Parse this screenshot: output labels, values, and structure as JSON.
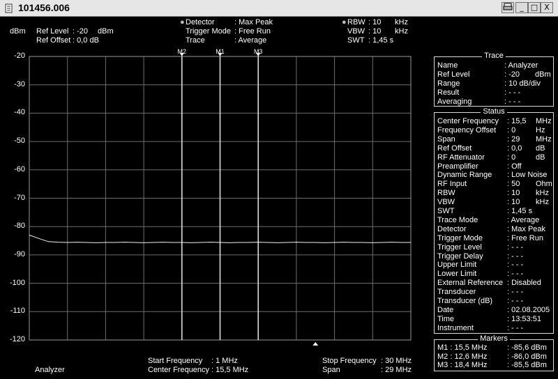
{
  "window": {
    "title": "101456.006",
    "minimize": "_",
    "maximize": "□",
    "close": "X"
  },
  "header": {
    "unit": "dBm",
    "ref_level_label": "Ref Level",
    "ref_level_value": ": -20",
    "ref_level_unit": "dBm",
    "ref_offset_label": "Ref Offset",
    "ref_offset_value": ": 0,0 dB",
    "detector_label": "Detector",
    "detector_value": ": Max Peak",
    "trigger_mode_label": "Trigger Mode",
    "trigger_mode_value": ": Free Run",
    "trace_label": "Trace",
    "trace_value": ": Average",
    "rbw_label": "RBW",
    "rbw_value": ": 10",
    "rbw_unit": "kHz",
    "vbw_label": "VBW",
    "vbw_value": ": 10",
    "vbw_unit": "kHz",
    "swt_label": "SWT",
    "swt_value": ": 1,45 s"
  },
  "chart_data": {
    "type": "line",
    "ylim": [
      -120,
      -20
    ],
    "yticks": [
      "-20",
      "-30",
      "-40",
      "-50",
      "-60",
      "-70",
      "-80",
      "-90",
      "-100",
      "-110",
      "-120"
    ],
    "xlim_mhz": [
      1,
      30
    ],
    "x_divisions": 10,
    "series": [
      {
        "values": [
          -83.0,
          -84.2,
          -85.3,
          -85.5,
          -85.6,
          -85.5,
          -85.6,
          -85.7,
          -85.6,
          -85.6,
          -85.5,
          -85.6,
          -85.7,
          -85.6,
          -85.5,
          -85.6,
          -85.6,
          -85.7,
          -85.6,
          -85.5,
          -85.6,
          -85.7,
          -85.6,
          -85.6,
          -85.5,
          -85.6,
          -85.7,
          -85.6,
          -85.5,
          -85.6,
          -85.6,
          -85.7,
          -85.6,
          -85.5,
          -85.6,
          -85.6,
          -85.7,
          -85.6,
          -85.5,
          -85.6,
          -85.6
        ]
      }
    ],
    "markers": [
      {
        "label": "M2",
        "x_mhz": 12.6
      },
      {
        "label": "M1",
        "x_mhz": 15.5
      },
      {
        "label": "M3",
        "x_mhz": 18.4
      }
    ]
  },
  "trace_panel": {
    "title": "Trace",
    "rows": [
      {
        "label": "Name",
        "value": ": Analyzer",
        "unit": ""
      },
      {
        "label": "Ref Level",
        "value": ": -20",
        "unit": "dBm"
      },
      {
        "label": "Range",
        "value": ": 10 dB/div",
        "unit": ""
      },
      {
        "label": "Result",
        "value": ": - - -",
        "unit": ""
      },
      {
        "label": "Averaging",
        "value": ": - - -",
        "unit": ""
      }
    ]
  },
  "status_panel": {
    "title": "Status",
    "rows": [
      {
        "label": "Center Frequency",
        "value": ": 15,5",
        "unit": "MHz"
      },
      {
        "label": "Frequency Offset",
        "value": ":   0",
        "unit": "Hz"
      },
      {
        "label": "Span",
        "value": ": 29",
        "unit": "MHz"
      },
      {
        "label": "Ref Offset",
        "value": ":   0,0",
        "unit": "dB"
      },
      {
        "label": "RF Attenuator",
        "value": ":   0",
        "unit": "dB"
      },
      {
        "label": "Preamplifier",
        "value": ": Off",
        "unit": ""
      },
      {
        "label": "Dynamic Range",
        "value": ": Low Noise",
        "unit": ""
      },
      {
        "label": "RF Input",
        "value": ": 50",
        "unit": "Ohm"
      },
      {
        "label": "RBW",
        "value": ": 10",
        "unit": "kHz"
      },
      {
        "label": "VBW",
        "value": ": 10",
        "unit": "kHz"
      },
      {
        "label": "SWT",
        "value": ":   1,45 s",
        "unit": ""
      },
      {
        "label": "Trace Mode",
        "value": ": Average",
        "unit": ""
      },
      {
        "label": "Detector",
        "value": ": Max Peak",
        "unit": ""
      },
      {
        "label": "Trigger Mode",
        "value": ": Free Run",
        "unit": ""
      },
      {
        "label": "Trigger Level",
        "value": ": - - -",
        "unit": ""
      },
      {
        "label": "Trigger Delay",
        "value": ": - - -",
        "unit": ""
      },
      {
        "label": "Upper Limit",
        "value": ": - - -",
        "unit": ""
      },
      {
        "label": "Lower Limit",
        "value": ": - - -",
        "unit": ""
      },
      {
        "label": "External Reference",
        "value": ": Disabled",
        "unit": ""
      },
      {
        "label": "Transducer",
        "value": ": - - -",
        "unit": ""
      },
      {
        "label": "Transducer (dB)",
        "value": ": - - -",
        "unit": ""
      },
      {
        "label": "Date",
        "value": ":   02.08.2005",
        "unit": ""
      },
      {
        "label": "Time",
        "value": ":   13:53:51",
        "unit": ""
      },
      {
        "label": "Instrument",
        "value": ": - - -",
        "unit": ""
      }
    ]
  },
  "markers_panel": {
    "title": "Markers",
    "rows": [
      {
        "name": "M1 : 15,5 MHz",
        "value": ":   -85,6 dBm"
      },
      {
        "name": "M2 : 12,6 MHz",
        "value": ":   -86,0 dBm"
      },
      {
        "name": "M3 : 18,4 MHz",
        "value": ":   -85,5 dBm"
      }
    ]
  },
  "footer": {
    "trace_name": "Analyzer",
    "start_label": "Start Frequency",
    "start_value": ":   1    MHz",
    "center_label": "Center Frequency",
    "center_value": ": 15,5 MHz",
    "stop_label": "Stop Frequency",
    "stop_value": ": 30 MHz",
    "span_label": "Span",
    "span_value": ": 29 MHz"
  }
}
